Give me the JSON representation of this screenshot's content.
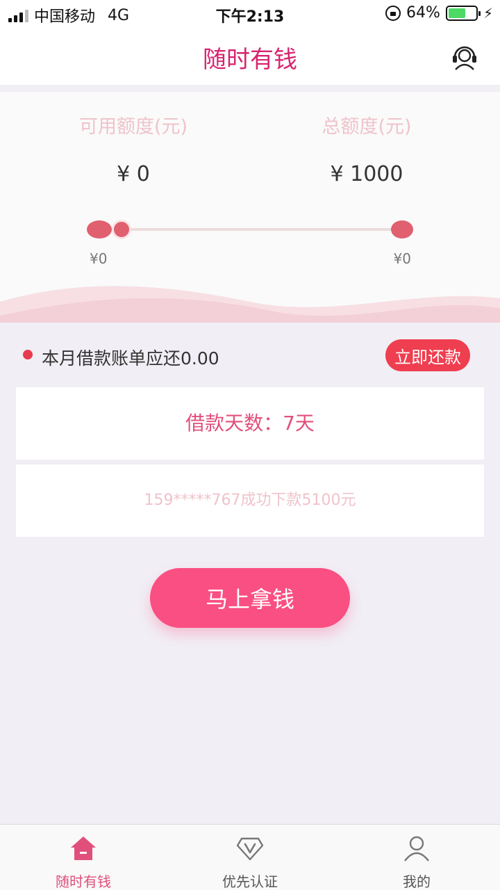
{
  "status_bar": {
    "carrier": "中国移动",
    "network": "4G",
    "time": "下午2:13",
    "battery": "64%",
    "battery_level": 0.64
  },
  "header": {
    "title": "随时有钱",
    "support_icon": "customer-service-headset-icon"
  },
  "quota": {
    "available_label": "可用额度(元)",
    "available_value": "¥ 0",
    "total_label": "总额度(元)",
    "total_value": "¥ 1000",
    "slider_min": "¥0",
    "slider_max": "¥0",
    "accent_color": "#e06070"
  },
  "bill": {
    "text": "本月借款账单应还0.00",
    "repay_button": "立即还款",
    "accent_color": "#ef3e4f"
  },
  "loan_days": "借款天数：7天",
  "notice": "159*****767成功下款5100元",
  "cta": {
    "label": "马上拿钱",
    "color": "#fa4f83"
  },
  "tabbar": {
    "tabs": [
      {
        "label": "随时有钱",
        "icon": "home-icon",
        "active": true
      },
      {
        "label": "优先认证",
        "icon": "diamond-v-icon",
        "active": false
      },
      {
        "label": "我的",
        "icon": "user-icon",
        "active": false
      }
    ],
    "active_color": "#e0507b"
  }
}
